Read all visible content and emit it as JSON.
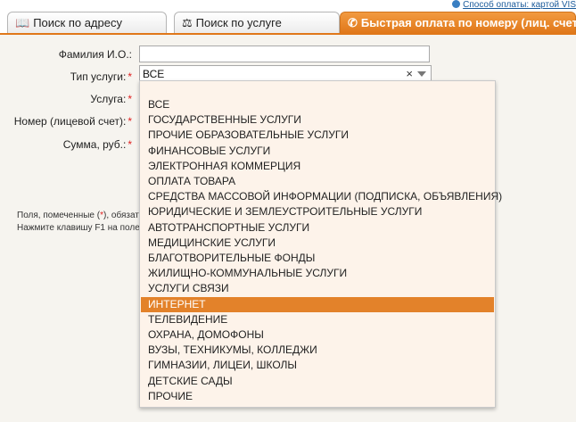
{
  "top_link": "Способ оплаты: картой VIS",
  "tabs": [
    {
      "label": "Поиск по адресу",
      "icon": "book-icon"
    },
    {
      "label": "Поиск по услуге",
      "icon": "scales-icon"
    },
    {
      "label": "Быстрая оплата по номеру (лиц. счету)",
      "icon": "phone-icon"
    }
  ],
  "form": {
    "fio_label": "Фамилия И.О.:",
    "service_type_label": "Тип услуги:",
    "service_label": "Услуга:",
    "account_label": "Номер (лицевой счет):",
    "amount_label": "Сумма, руб.:",
    "required_mark": "*",
    "fio_value": "",
    "service_type_value": "ВСЕ",
    "clear_glyph": "×"
  },
  "notes": {
    "line1_a": "Поля, помеченные (",
    "line1_b": "*",
    "line1_c": "), обязате",
    "line2": "Нажмите клавишу F1 на поле,"
  },
  "dropdown": {
    "selected_index": 13,
    "options": [
      "ВСЕ",
      "ГОСУДАРСТВЕННЫЕ УСЛУГИ",
      "ПРОЧИЕ ОБРАЗОВАТЕЛЬНЫЕ УСЛУГИ",
      "ФИНАНСОВЫЕ УСЛУГИ",
      "ЭЛЕКТРОННАЯ КОММЕРЦИЯ",
      "ОПЛАТА ТОВАРА",
      "СРЕДСТВА МАССОВОЙ ИНФОРМАЦИИ (ПОДПИСКА, ОБЪЯВЛЕНИЯ)",
      "ЮРИДИЧЕСКИЕ И ЗЕМЛЕУСТРОИТЕЛЬНЫЕ УСЛУГИ",
      "АВТОТРАНСПОРТНЫЕ УСЛУГИ",
      "МЕДИЦИНСКИЕ УСЛУГИ",
      "БЛАГОТВОРИТЕЛЬНЫЕ ФОНДЫ",
      "ЖИЛИЩНО-КОММУНАЛЬНЫЕ УСЛУГИ",
      "УСЛУГИ СВЯЗИ",
      "ИНТЕРНЕТ",
      "ТЕЛЕВИДЕНИЕ",
      "ОХРАНА, ДОМОФОНЫ",
      "ВУЗЫ, ТЕХНИКУМЫ, КОЛЛЕДЖИ",
      "ГИМНАЗИИ, ЛИЦЕИ, ШКОЛЫ",
      "ДЕТСКИЕ САДЫ",
      "ПРОЧИЕ"
    ]
  },
  "colors": {
    "accent": "#e0781a",
    "selected": "#e3822a",
    "panel": "#f6f4ef",
    "dropdown": "#fdf3ea"
  }
}
